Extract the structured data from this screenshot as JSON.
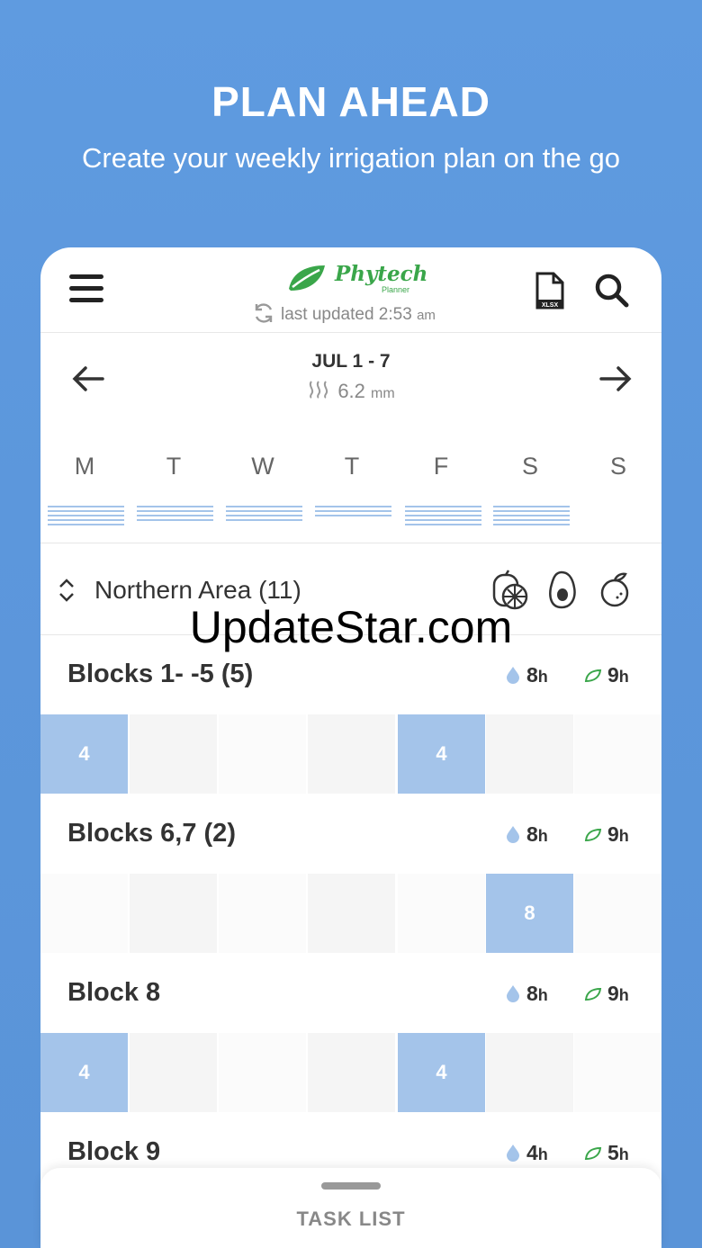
{
  "promo": {
    "title": "PLAN AHEAD",
    "subtitle": "Create your weekly irrigation plan on the go"
  },
  "header": {
    "logo_name": "Phytech",
    "logo_sub": "Planner",
    "updated_label": "last updated 2:53",
    "updated_suffix": "am",
    "export_icon": "xlsx-file-icon",
    "search_icon": "search-icon"
  },
  "week": {
    "range": "JUL 1 - 7",
    "rain_value": "6.2",
    "rain_unit": "mm",
    "days": [
      "M",
      "T",
      "W",
      "T",
      "F",
      "S",
      "S"
    ],
    "day_bar_lines": [
      5,
      4,
      4,
      3,
      5,
      5,
      0
    ]
  },
  "area": {
    "name": "Northern Area (11)",
    "crop_icons": [
      "citrus-icon",
      "avocado-icon",
      "orange-icon"
    ]
  },
  "blocks": [
    {
      "title": "Blocks 1- -5 (5)",
      "water": "8",
      "crop": "9",
      "cells": [
        "4",
        "",
        "",
        "",
        "4",
        "",
        ""
      ]
    },
    {
      "title": "Blocks 6,7 (2)",
      "water": "8",
      "crop": "9",
      "cells": [
        "",
        "",
        "",
        "",
        "",
        "8",
        ""
      ]
    },
    {
      "title": "Block 8",
      "water": "8",
      "crop": "9",
      "cells": [
        "4",
        "",
        "",
        "",
        "4",
        "",
        ""
      ]
    },
    {
      "title": "Block 9",
      "water": "4",
      "crop": "5",
      "cells": []
    }
  ],
  "hour_unit": "h",
  "watermark": "UpdateStar.com",
  "footer": {
    "task_list": "TASK LIST"
  },
  "colors": {
    "accent": "#a4c4ea",
    "brand_green": "#3aa64a",
    "background": "#5c97dc"
  }
}
